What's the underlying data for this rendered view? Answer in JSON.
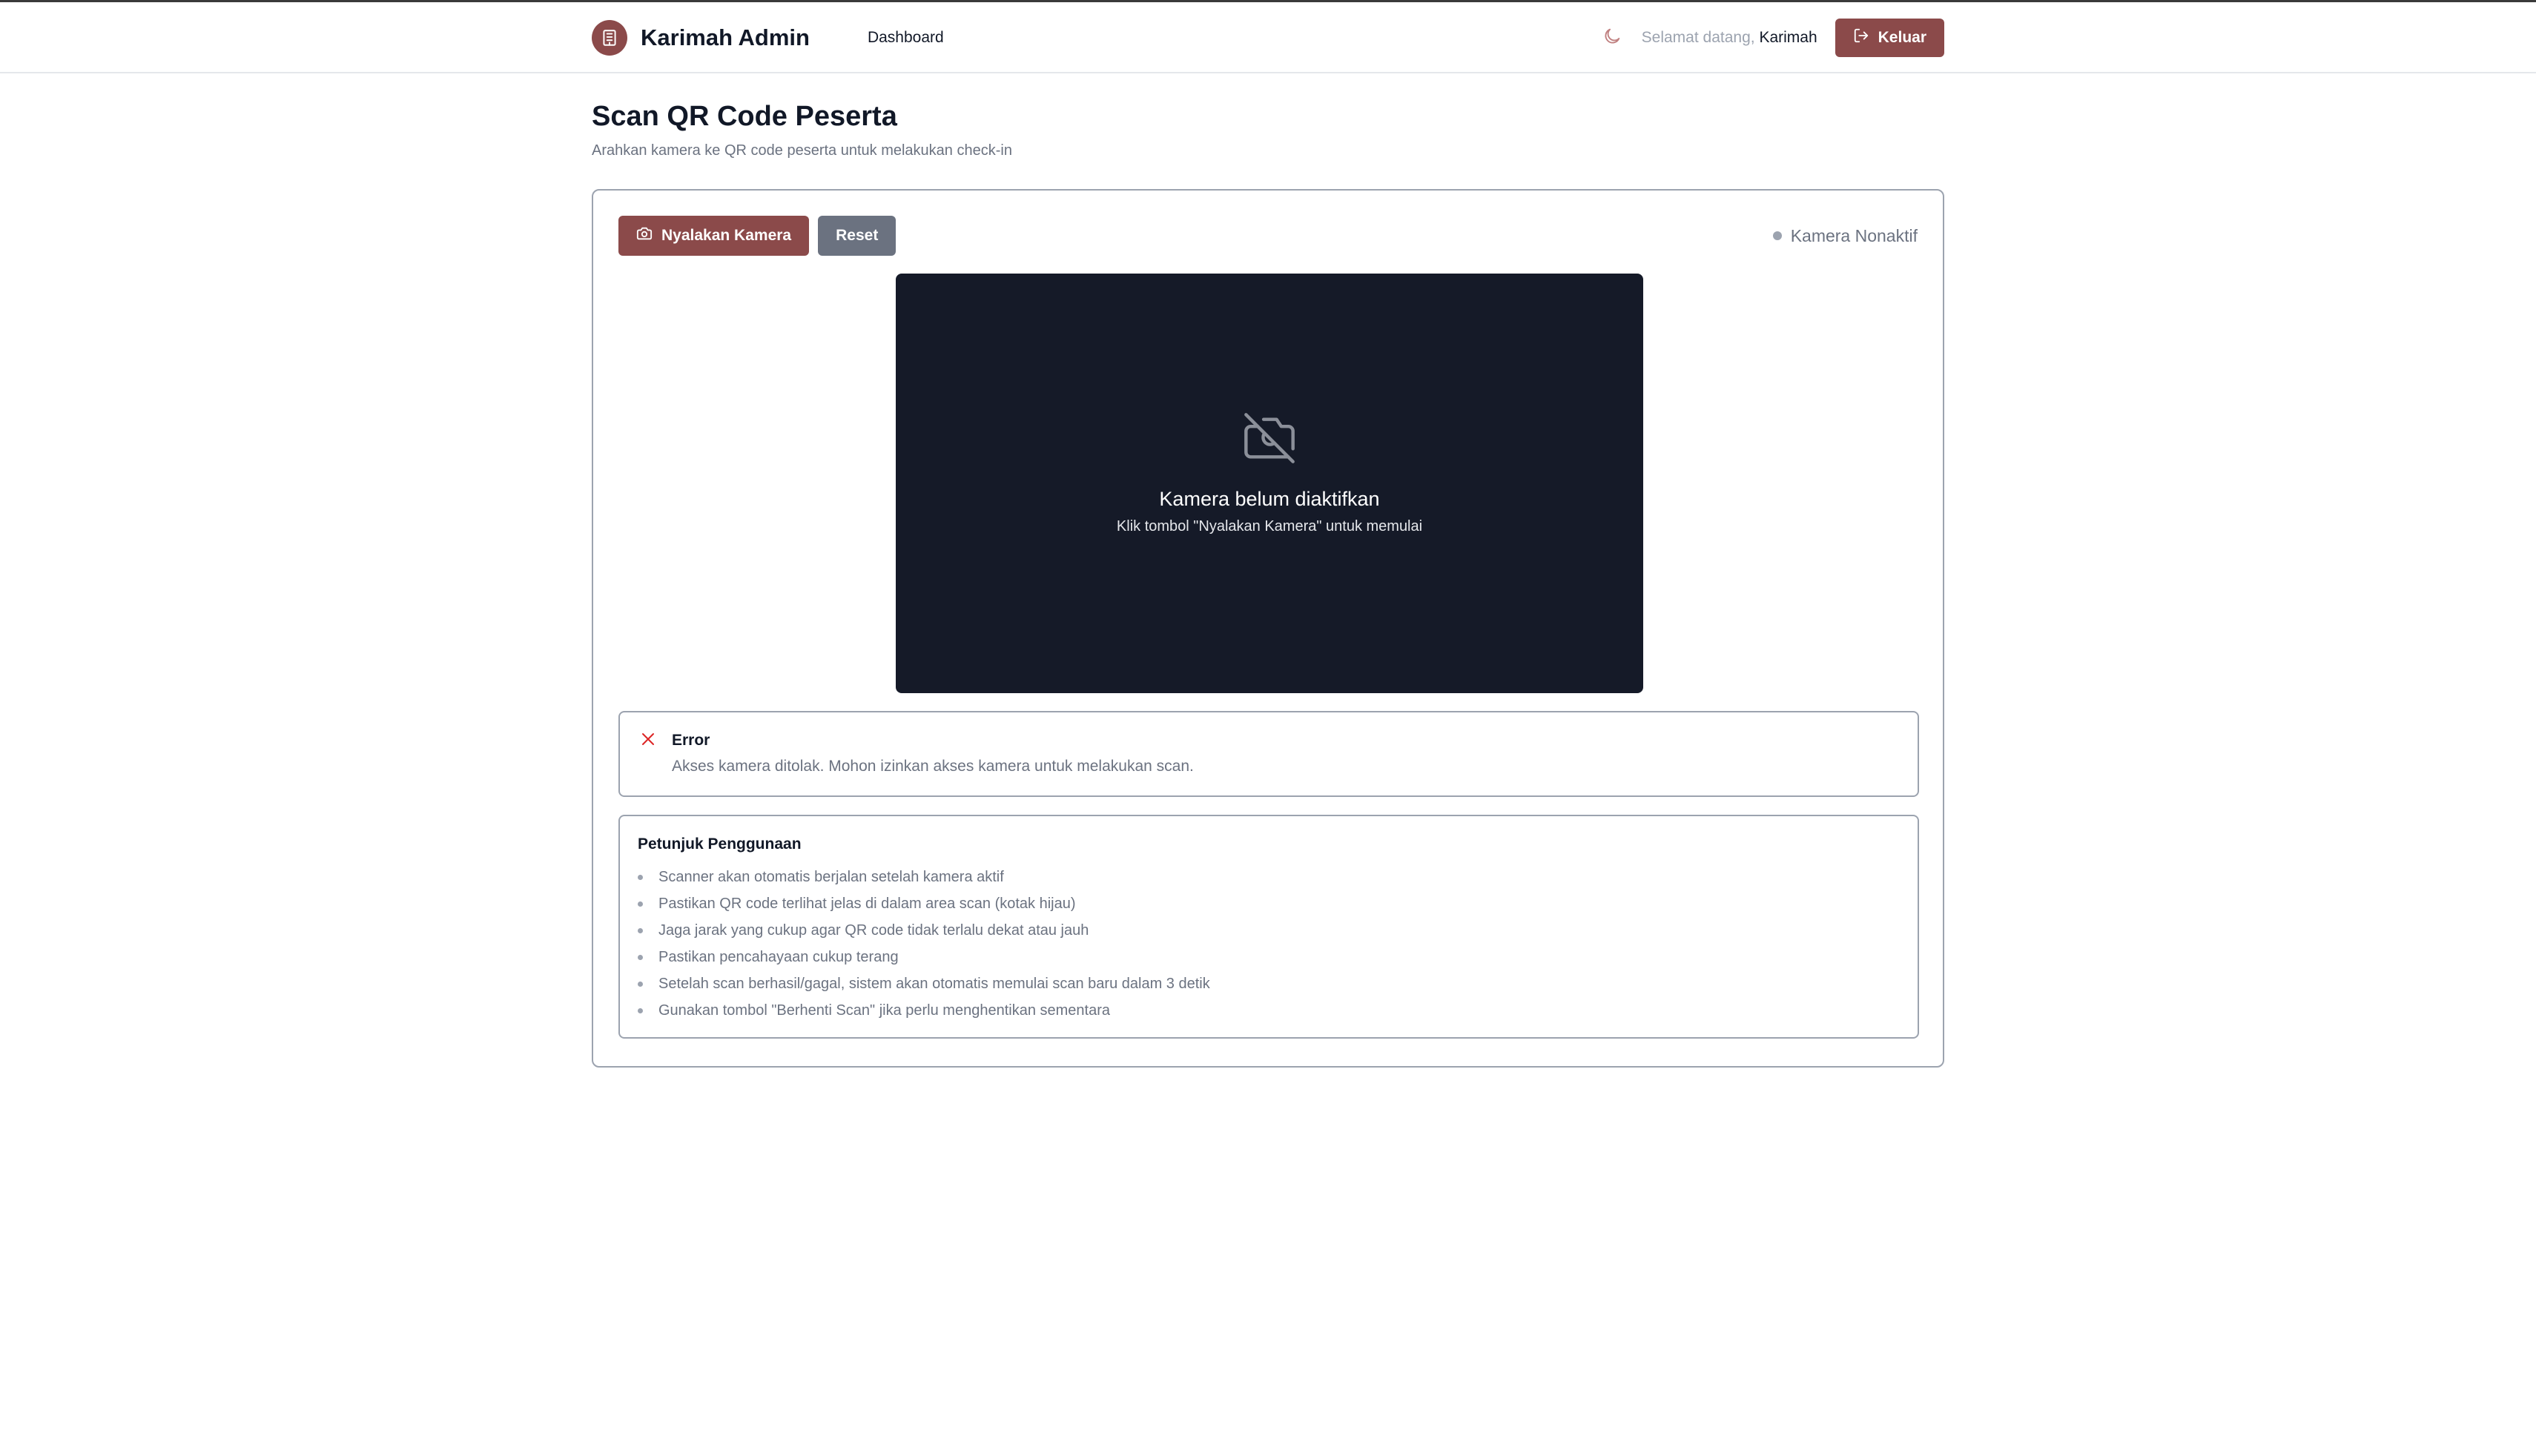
{
  "brand": {
    "title": "Karimah Admin"
  },
  "nav": {
    "dashboard": "Dashboard"
  },
  "user": {
    "welcome_prefix": "Selamat datang,",
    "name": "Karimah",
    "logout_label": "Keluar"
  },
  "page": {
    "title": "Scan QR Code Peserta",
    "subtitle": "Arahkan kamera ke QR code peserta untuk melakukan check-in"
  },
  "controls": {
    "start_camera_label": "Nyalakan Kamera",
    "reset_label": "Reset",
    "camera_status": "Kamera Nonaktif"
  },
  "camera": {
    "title": "Kamera belum diaktifkan",
    "hint": "Klik tombol \"Nyalakan Kamera\" untuk memulai"
  },
  "error": {
    "title": "Error",
    "message": "Akses kamera ditolak. Mohon izinkan akses kamera untuk melakukan scan."
  },
  "guide": {
    "title": "Petunjuk Penggunaan",
    "items": [
      "Scanner akan otomatis berjalan setelah kamera aktif",
      "Pastikan QR code terlihat jelas di dalam area scan (kotak hijau)",
      "Jaga jarak yang cukup agar QR code tidak terlalu dekat atau jauh",
      "Pastikan pencahayaan cukup terang",
      "Setelah scan berhasil/gagal, sistem akan otomatis memulai scan baru dalam 3 detik",
      "Gunakan tombol \"Berhenti Scan\" jika perlu menghentikan sementara"
    ]
  },
  "colors": {
    "accent": "#8b4a4a",
    "secondary_button": "#6b7280",
    "camera_background": "#151a28",
    "error": "#dc2626"
  },
  "icons": {
    "logo": "building-icon",
    "theme": "moon-icon",
    "logout": "logout-icon",
    "camera": "camera-icon",
    "camera_off": "camera-off-icon",
    "error": "close-icon"
  }
}
